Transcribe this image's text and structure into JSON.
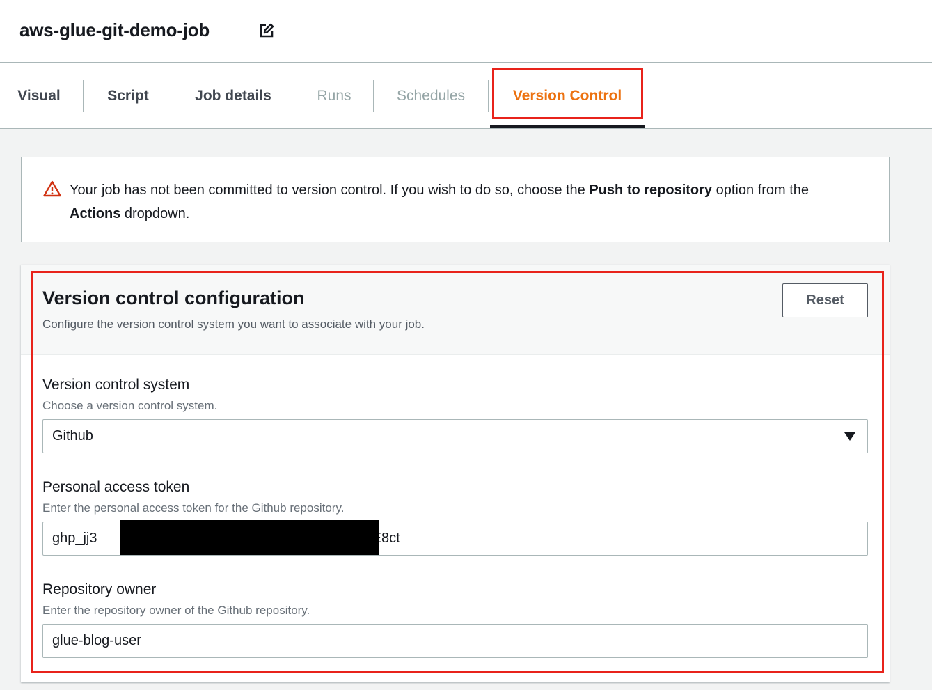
{
  "header": {
    "job_title": "aws-glue-git-demo-job",
    "edit_icon": "edit-icon"
  },
  "tabs": [
    {
      "label": "Visual",
      "state": "enabled"
    },
    {
      "label": "Script",
      "state": "enabled"
    },
    {
      "label": "Job details",
      "state": "enabled"
    },
    {
      "label": "Runs",
      "state": "disabled"
    },
    {
      "label": "Schedules",
      "state": "disabled"
    },
    {
      "label": "Version Control",
      "state": "active"
    }
  ],
  "alert": {
    "icon": "warning-icon",
    "text_1": "Your job has not been committed to version control. If you wish to do so, choose the ",
    "bold_1": "Push to repository",
    "text_2": " option from the ",
    "bold_2": "Actions",
    "text_3": " dropdown."
  },
  "panel": {
    "title": "Version control configuration",
    "description": "Configure the version control system you want to associate with your job.",
    "reset_label": "Reset"
  },
  "fields": {
    "vcs": {
      "label": "Version control system",
      "hint": "Choose a version control system.",
      "value": "Github"
    },
    "token": {
      "label": "Personal access token",
      "hint": "Enter the personal access token for the Github repository.",
      "value_start": "ghp_jj3",
      "value_end": "4QE8ct"
    },
    "owner": {
      "label": "Repository owner",
      "hint": "Enter the repository owner of the Github repository.",
      "value": "glue-blog-user"
    }
  },
  "colors": {
    "accent_orange": "#ec7211",
    "highlight_red": "#e8231b",
    "warning_red": "#d13212"
  }
}
